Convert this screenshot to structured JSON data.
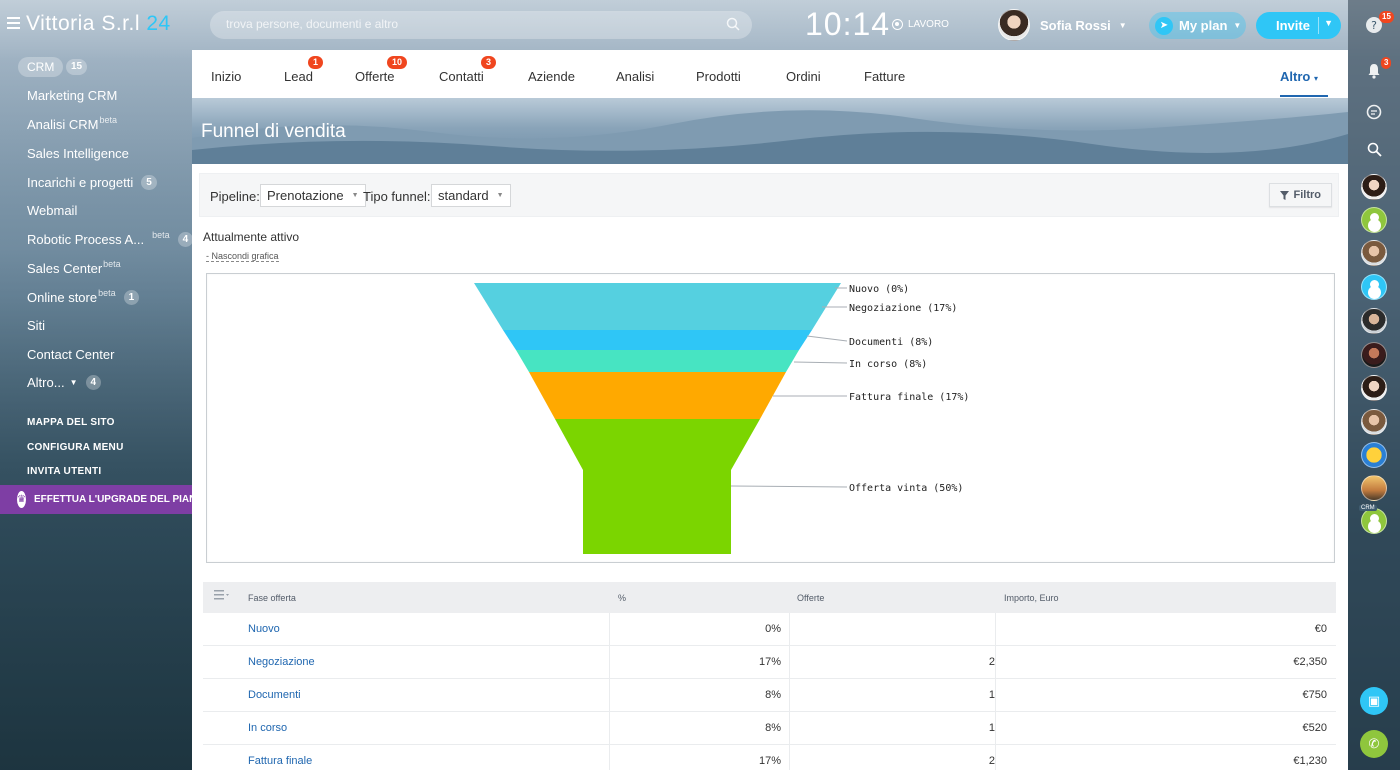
{
  "header": {
    "brand_name": "Vittoria S.r.l",
    "brand_suffix": "24",
    "search_placeholder": "trova persone, documenti e altro",
    "clock": "10:14",
    "work_status": "LAVORO",
    "user_name": "Sofia Rossi",
    "myplan_label": "My plan",
    "invite_label": "Invite"
  },
  "sidebar": {
    "crm_label": "CRM",
    "crm_count": "15",
    "items": [
      {
        "label": "Marketing CRM",
        "sup": "",
        "badge": ""
      },
      {
        "label": "Analisi CRM",
        "sup": "beta",
        "badge": ""
      },
      {
        "label": "Sales Intelligence",
        "sup": "",
        "badge": ""
      },
      {
        "label": "Incarichi e progetti",
        "sup": "",
        "badge": "5"
      },
      {
        "label": "Webmail",
        "sup": "",
        "badge": ""
      },
      {
        "label": "Robotic Process A...",
        "sup": "beta",
        "badge": "4"
      },
      {
        "label": "Sales Center",
        "sup": "beta",
        "badge": ""
      },
      {
        "label": "Online store",
        "sup": "beta",
        "badge": "1"
      },
      {
        "label": "Siti",
        "sup": "",
        "badge": ""
      },
      {
        "label": "Contact Center",
        "sup": "",
        "badge": ""
      },
      {
        "label": "Altro...",
        "sup": "",
        "badge": "4"
      }
    ],
    "site_map": "MAPPA DEL SITO",
    "configure_menu": "CONFIGURA MENU",
    "invite_users": "INVITA UTENTI",
    "upgrade": "EFFETTUA L'UPGRADE DEL PIANO"
  },
  "tabs": {
    "items": [
      {
        "label": "Inizio",
        "count": ""
      },
      {
        "label": "Lead",
        "count": "1"
      },
      {
        "label": "Offerte",
        "count": "10"
      },
      {
        "label": "Contatti",
        "count": "3"
      },
      {
        "label": "Aziende",
        "count": ""
      },
      {
        "label": "Analisi",
        "count": ""
      },
      {
        "label": "Prodotti",
        "count": ""
      },
      {
        "label": "Ordini",
        "count": ""
      },
      {
        "label": "Fatture",
        "count": ""
      }
    ],
    "more_label": "Altro"
  },
  "page_title": "Funnel di vendita",
  "filters": {
    "pipeline_label": "Pipeline:",
    "pipeline_value": "Prenotazione",
    "funnel_type_label": "Tipo funnel:",
    "funnel_type_value": "standard",
    "filter_button": "Filtro"
  },
  "active_title": "Attualmente attivo",
  "hide_chart": "Nascondi grafica",
  "funnel": [
    {
      "label": "Nuovo (0%)",
      "color": "#55d0e0"
    },
    {
      "label": "Negoziazione (17%)",
      "color": "#55d0e0"
    },
    {
      "label": "Documenti (8%)",
      "color": "#2fc6f6"
    },
    {
      "label": "In corso (8%)",
      "color": "#47e4c2"
    },
    {
      "label": "Fattura finale (17%)",
      "color": "#ffa900"
    },
    {
      "label": "Offerta vinta (50%)",
      "color": "#7bd500"
    }
  ],
  "table": {
    "headers": [
      "Fase offerta",
      "%",
      "Offerte",
      "Importo, Euro"
    ],
    "rows": [
      {
        "stage": "Nuovo",
        "pct": "0%",
        "deals": "",
        "amount": "€0"
      },
      {
        "stage": "Negoziazione",
        "pct": "17%",
        "deals": "2",
        "amount": "€2,350"
      },
      {
        "stage": "Documenti",
        "pct": "8%",
        "deals": "1",
        "amount": "€750"
      },
      {
        "stage": "In corso",
        "pct": "8%",
        "deals": "1",
        "amount": "€520"
      },
      {
        "stage": "Fattura finale",
        "pct": "17%",
        "deals": "2",
        "amount": "€1,230"
      }
    ]
  },
  "rightbar": {
    "help_badge": "15",
    "notifications_badge": "3",
    "crm_tag": "CRM"
  }
}
